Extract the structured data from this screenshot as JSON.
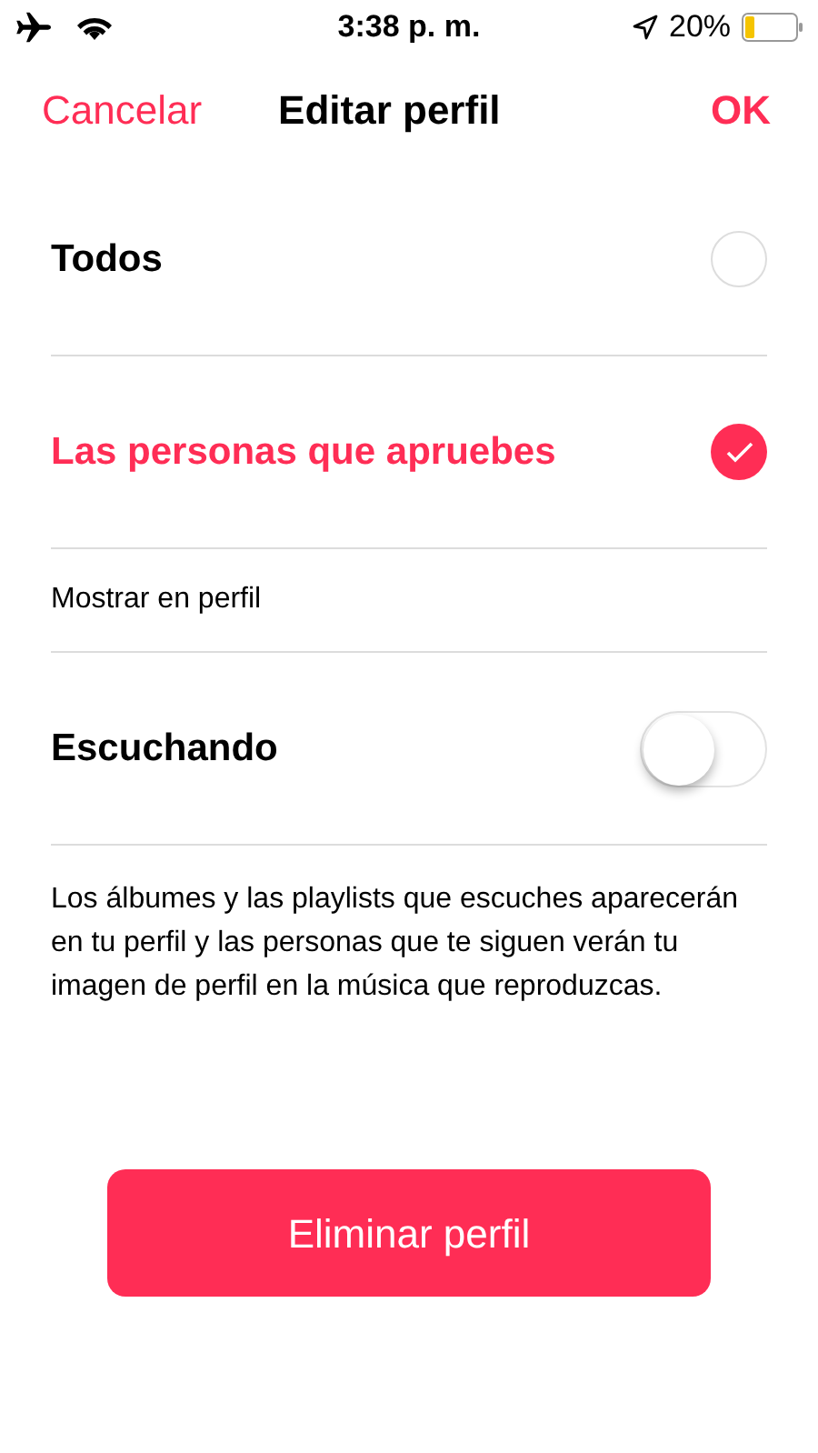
{
  "status_bar": {
    "time": "3:38 p. m.",
    "battery": "20%"
  },
  "nav": {
    "cancel": "Cancelar",
    "title": "Editar perfil",
    "ok": "OK"
  },
  "options": [
    {
      "label": "Todos",
      "selected": false
    },
    {
      "label": "Las personas que apruebes",
      "selected": true
    }
  ],
  "section_header": "Mostrar en perfil",
  "toggles": [
    {
      "label": "Escuchando",
      "on": false
    }
  ],
  "description": "Los álbumes y las playlists que escuches aparecerán en tu perfil y las personas que te siguen verán tu imagen de perfil en la música que reproduzcas.",
  "delete_button": "Eliminar perfil"
}
